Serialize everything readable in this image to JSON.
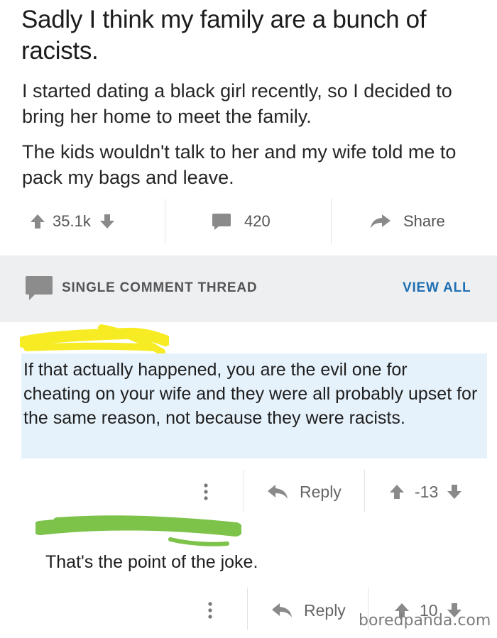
{
  "post": {
    "title": "Sadly I think my family are a bunch of racists.",
    "body_p1": "I started dating a black girl recently, so I decided to bring her home to meet the family.",
    "body_p2": "The kids wouldn't talk to her and my wife told me to pack my bags and leave.",
    "upvotes": "35.1k",
    "comments_count": "420",
    "share_label": "Share"
  },
  "thread": {
    "title": "SINGLE COMMENT THREAD",
    "view_all": "VIEW ALL"
  },
  "comments": [
    {
      "text": "If that actually happened, you are the evil one for cheating on your wife and they were all probably upset for the same reason, not because they were racists.",
      "reply_label": "Reply",
      "score": "-13"
    },
    {
      "text": "That's the point of the joke.",
      "reply_label": "Reply",
      "score": "10"
    }
  ],
  "watermark": "boredpanda.com",
  "colors": {
    "accent_blue": "#1f6fb3",
    "highlight_bg": "#e6f2fb",
    "header_bg": "#eeeff1",
    "redaction_yellow": "#f7ec24",
    "redaction_green": "#7dc34a"
  }
}
